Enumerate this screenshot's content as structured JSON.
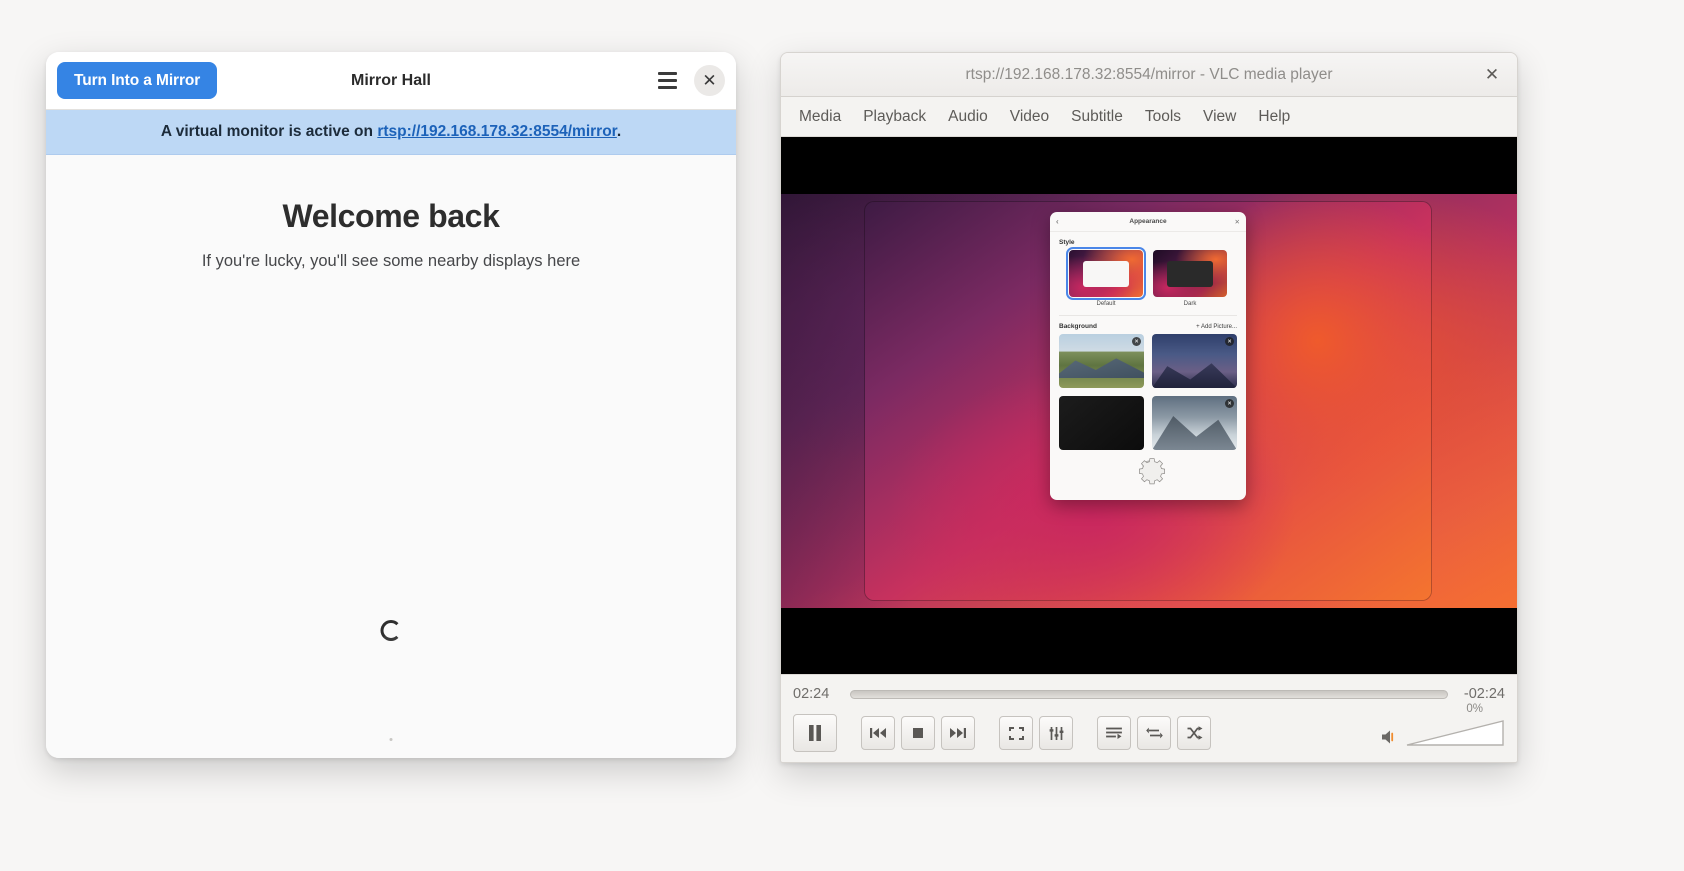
{
  "mirror_hall": {
    "window_title": "Mirror Hall",
    "mirror_button_label": "Turn Into a Mirror",
    "menu_icon": "hamburger-menu-icon",
    "close_icon": "close-icon",
    "banner": {
      "prefix": "A virtual monitor is active on ",
      "link_text": "rtsp://192.168.178.32:8554/mirror",
      "suffix": ".",
      "background_color": "#bdd8f5",
      "link_color": "#1c62b9"
    },
    "welcome_heading": "Welcome back",
    "welcome_subtitle": "If you're lucky, you'll see some nearby displays here",
    "spinner": "loading-spinner",
    "accent_color": "#3584e4"
  },
  "vlc": {
    "window_title": "rtsp://192.168.178.32:8554/mirror - VLC media player",
    "close_icon": "close-icon",
    "menus": [
      {
        "label": "Media"
      },
      {
        "label": "Playback"
      },
      {
        "label": "Audio"
      },
      {
        "label": "Video"
      },
      {
        "label": "Subtitle"
      },
      {
        "label": "Tools"
      },
      {
        "label": "View"
      },
      {
        "label": "Help"
      }
    ],
    "elapsed_time": "02:24",
    "remaining_time": "-02:24",
    "seek_position_percent": 0,
    "volume_label": "0%",
    "volume_percent": 0,
    "controls": [
      {
        "name": "pause-button",
        "icon": "pause-icon"
      },
      {
        "name": "previous-button",
        "icon": "previous-icon"
      },
      {
        "name": "stop-button",
        "icon": "stop-icon"
      },
      {
        "name": "next-button",
        "icon": "next-icon"
      },
      {
        "name": "fullscreen-button",
        "icon": "fullscreen-icon"
      },
      {
        "name": "equalizer-button",
        "icon": "equalizer-icon"
      },
      {
        "name": "playlist-button",
        "icon": "playlist-icon"
      },
      {
        "name": "loop-button",
        "icon": "loop-icon"
      },
      {
        "name": "shuffle-button",
        "icon": "shuffle-icon"
      }
    ],
    "stream_content": {
      "dialog_title": "Appearance",
      "back_icon": "back-chevron-icon",
      "close_icon": "close-icon",
      "style_label": "Style",
      "style_options": [
        {
          "caption": "Default",
          "selected": true
        },
        {
          "caption": "Dark",
          "selected": false
        }
      ],
      "background_label": "Background",
      "add_picture_label": "+ Add Picture...",
      "backgrounds": [
        {
          "name": "mountain-meadow"
        },
        {
          "name": "night-mountains"
        },
        {
          "name": "dark-solid"
        },
        {
          "name": "snow-peaks"
        }
      ],
      "overlay_icon": "gear-icon"
    }
  }
}
